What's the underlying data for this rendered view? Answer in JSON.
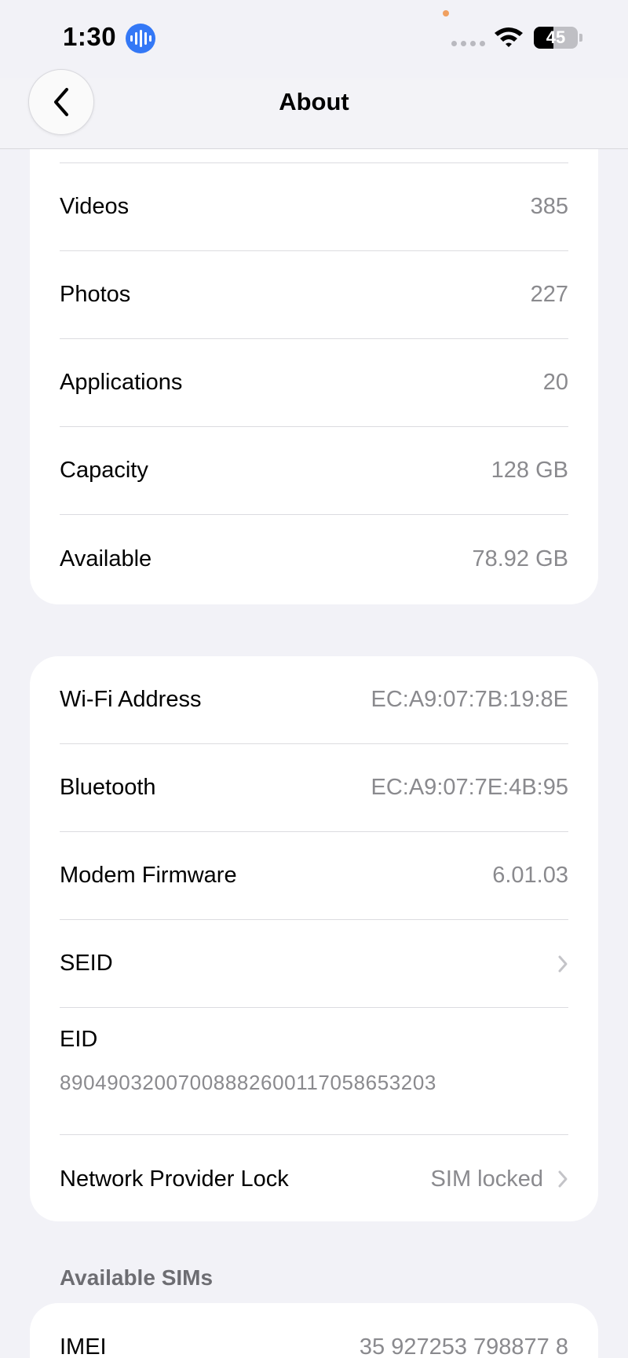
{
  "status_bar": {
    "time": "1:30",
    "battery_percent": "45",
    "battery_level": 0.45
  },
  "nav": {
    "title": "About",
    "back_icon": "chevron-left-icon"
  },
  "storage_rows": [
    {
      "label": "Videos",
      "value": "385"
    },
    {
      "label": "Photos",
      "value": "227"
    },
    {
      "label": "Applications",
      "value": "20"
    },
    {
      "label": "Capacity",
      "value": "128 GB"
    },
    {
      "label": "Available",
      "value": "78.92 GB"
    }
  ],
  "network_rows": [
    {
      "label": "Wi-Fi Address",
      "value": "EC:A9:07:7B:19:8E"
    },
    {
      "label": "Bluetooth",
      "value": "EC:A9:07:7E:4B:95"
    },
    {
      "label": "Modem Firmware",
      "value": "6.01.03"
    },
    {
      "label": "SEID",
      "value": ""
    }
  ],
  "eid": {
    "label": "EID",
    "value": "89049032007008882600117058653203"
  },
  "network_lock": {
    "label": "Network Provider Lock",
    "value": "SIM locked"
  },
  "sims": {
    "header": "Available SIMs",
    "imei_label": "IMEI",
    "imei_value": "35 927253 798877 8"
  },
  "colors": {
    "background": "#f2f2f7",
    "card": "#ffffff",
    "secondary_text": "#8a8a8e",
    "siri_blue": "#3478f6"
  }
}
